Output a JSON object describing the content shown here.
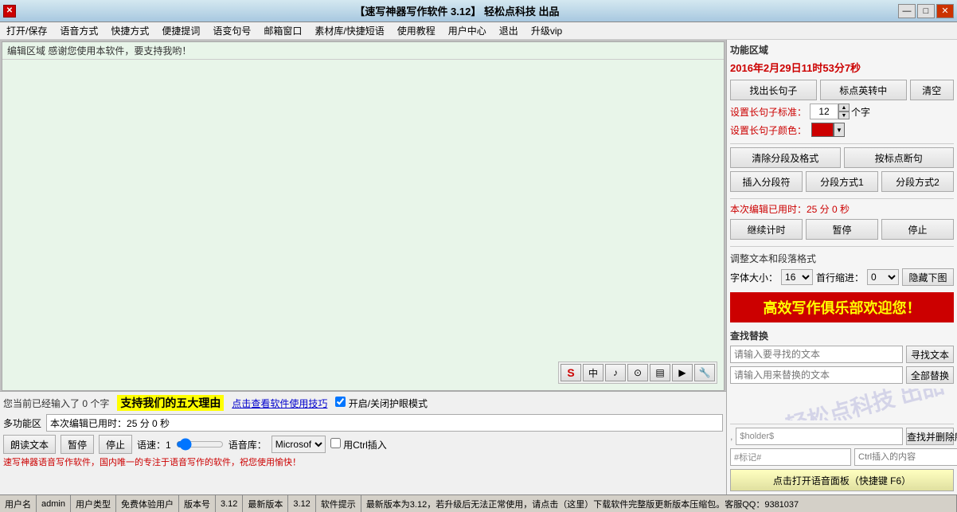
{
  "titlebar": {
    "title": "【速写神器写作软件 3.12】  轻松点科技  出品",
    "minimize": "—",
    "maximize": "□",
    "close": "✕"
  },
  "menu": {
    "items": [
      "打开/保存",
      "语音方式",
      "快捷方式",
      "便捷提词",
      "语变句号",
      "邮箱窗口",
      "素材库/快捷短语",
      "使用教程",
      "用户中心",
      "退出",
      "升级vip"
    ]
  },
  "editor": {
    "label": "编辑区域  感谢您使用本软件，要支持我哟！",
    "content": "",
    "toolbar_items": [
      "S",
      "中",
      "♪",
      "⊙",
      "▤",
      "▶",
      "🔧"
    ]
  },
  "right_panel": {
    "section_title": "功能区域",
    "date": "2016年2月29日11时53分7秒",
    "btn_extract": "找出长句子",
    "btn_mark_en": "标点英转中",
    "btn_clear": "清空",
    "setting_threshold_label": "设置长句子标准：",
    "setting_threshold_value": "12",
    "setting_threshold_unit": "个字",
    "setting_color_label": "设置长句子颜色：",
    "btn_clear_format": "清除分段及格式",
    "btn_by_punct": "按标点断句",
    "btn_insert_seg": "插入分段符",
    "btn_seg_mode1": "分段方式1",
    "btn_seg_mode2": "分段方式2",
    "timer_label": "本次编辑已用时：25 分 0 秒",
    "btn_continue": "继续计时",
    "btn_pause": "暂停",
    "btn_stop": "停止",
    "adjust_title": "调整文本和段落格式",
    "font_size_label": "字体大小：",
    "font_size_value": "16",
    "indent_label": "首行缩进：",
    "indent_value": "0",
    "btn_hide_img": "隐藏下图",
    "promo_text": "高效写作俱乐部欢迎您！",
    "search_title": "查找替换",
    "search_placeholder": "请输入要寻找的文本",
    "btn_find": "寻找文本",
    "replace_placeholder": "请输入用来替换的文本",
    "btn_replace_all": "全部替换",
    "company_label": "轻松点科技  出品"
  },
  "bottom": {
    "char_count": "您当前已经输入了 0 个字",
    "support_text": "支持我们的五大理由",
    "tips_link": "点击查看软件使用技巧",
    "eyecare_label": "开启/关闭护眼模式",
    "multifunc_label": "多功能区",
    "timer_display": "本次编辑已用时：25 分 0 秒",
    "placeholder_input": "本次编辑已用时：25 分 0 秒",
    "btn_read": "朗读文本",
    "btn_pause_read": "暂停",
    "btn_stop_read": "停止",
    "speed_label": "语速：1",
    "lib_label": "语音库：",
    "lib_value": "Microsof",
    "ctrl_label": "用Ctrl插入",
    "tts_warning": "速写神器语音写作软件，国内唯一的专注于语音写作的软件，祝您使用愉快！",
    "open_panel_label": ",",
    "placeholder_holder": "$holder$",
    "btn_find_delete": "查找并删除所有",
    "tag_label": "#标记#",
    "ctrl_insert_label": "Ctrl插入的内容",
    "btn_open_panel": "点击打开语音面板（快捷键 F6）"
  },
  "statusbar": {
    "user_label": "用户名",
    "user_value": "admin",
    "type_label": "用户类型",
    "type_value": "免费体验用户",
    "version_label": "版本号",
    "version_value": "3.12",
    "latest_label": "最新版本",
    "latest_value": "3.12",
    "tip_label": "软件提示",
    "tip_text": "最新版本为3.12，若升级后无法正常使用，请点击（这里）下载软件完整版更新版本压缩包。客服QQ：9381037"
  }
}
